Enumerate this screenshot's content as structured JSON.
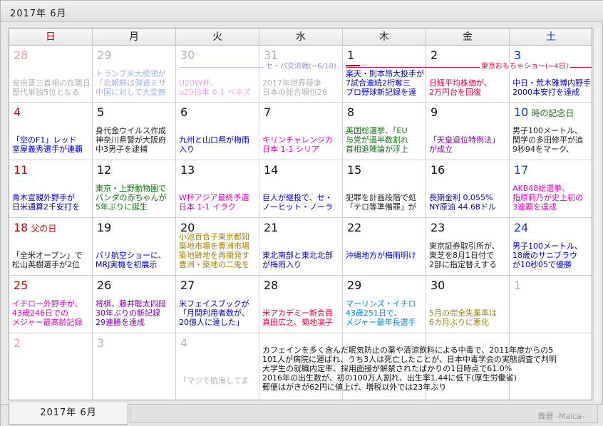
{
  "title": "2017年 6月",
  "brand": "舞暦 -Maica-",
  "tab_label": "2017年 6月",
  "weekdays": [
    "日",
    "月",
    "火",
    "水",
    "木",
    "金",
    "土"
  ],
  "span_events": [
    {
      "label": "セ・パ交流戦(~6/18)",
      "color": "#c0c0e0"
    },
    {
      "label": "東京おもちゃショー(~4日)",
      "color": "#e00040"
    }
  ],
  "weeks": [
    [
      {
        "num": "28",
        "cls": "other-sun",
        "news": [
          [
            "安倍晋三首相の在職日",
            "#b0b0b0"
          ],
          [
            "歴代単独5位となる",
            "#b0b0b0"
          ]
        ]
      },
      {
        "num": "29",
        "cls": "other",
        "news": [
          [
            "トランプ米大統領が",
            "#a0b0e0"
          ],
          [
            "「北朝鮮は弾道ミサ",
            "#a0b0e0"
          ],
          [
            "中国に対して大変無",
            "#a0b0e0"
          ]
        ]
      },
      {
        "num": "30",
        "cls": "other",
        "news": [
          [
            "U20W杯、",
            "#f0a0e0"
          ],
          [
            "u20日本 0-1 ベネズ",
            "#f0a0e0"
          ]
        ]
      },
      {
        "num": "31",
        "cls": "other",
        "news": [
          [
            "2017年世界競争",
            "#b0b0b0"
          ],
          [
            "日本の総合順位26",
            "#b0b0b0"
          ]
        ]
      },
      {
        "num": "1",
        "cls": "",
        "news": [
          [
            "楽天・則本昂大投手が",
            "#0000d0"
          ],
          [
            "7試合連続2桁奪三",
            "#0000d0"
          ],
          [
            "プロ野球新記録を達",
            "#0000d0"
          ]
        ]
      },
      {
        "num": "2",
        "cls": "",
        "news": [
          [
            "日経平均株価が、",
            "#e00040"
          ],
          [
            "2万円台を回復",
            "#e00040"
          ]
        ]
      },
      {
        "num": "3",
        "cls": "sat",
        "news": [
          [
            "中日・荒木雅博内野手",
            "#0000d0"
          ],
          [
            "2000本安打を達成",
            "#0000d0"
          ]
        ]
      }
    ],
    [
      {
        "num": "4",
        "cls": "sun",
        "news": [
          [
            "「空のF1」レッド",
            "#0000d0"
          ],
          [
            "室屋義秀選手が連覇",
            "#0000d0"
          ]
        ]
      },
      {
        "num": "5",
        "cls": "",
        "news": [
          [
            "身代金ウイルス作成",
            "#222222"
          ],
          [
            "神奈川県警が大阪府",
            "#222222"
          ],
          [
            "中3男子を逮捕",
            "#222222"
          ]
        ]
      },
      {
        "num": "6",
        "cls": "",
        "news": [
          [
            "九州と山口県が梅雨",
            "#0000d0"
          ],
          [
            "入り",
            "#0000d0"
          ]
        ]
      },
      {
        "num": "7",
        "cls": "",
        "news": [
          [
            "キリンチャレンジカ",
            "#e000c0"
          ],
          [
            "日本 1-1 シリア",
            "#e000c0"
          ]
        ]
      },
      {
        "num": "8",
        "cls": "",
        "news": [
          [
            "英国総選挙、「EU",
            "#107010"
          ],
          [
            "与党が過半数割れ",
            "#107010"
          ],
          [
            "首相退陣論が浮上",
            "#107010"
          ]
        ]
      },
      {
        "num": "9",
        "cls": "",
        "news": [
          [
            "「天皇退位特例法」",
            "#8000a0"
          ],
          [
            "が成立",
            "#8000a0"
          ]
        ]
      },
      {
        "num": "10",
        "cls": "sat",
        "holiday": "時の記念日",
        "news": [
          [
            "男子100メートル、",
            "#222222"
          ],
          [
            "関学の多田修平が追",
            "#222222"
          ],
          [
            "9秒94をマーク、",
            "#222222"
          ]
        ]
      }
    ],
    [
      {
        "num": "11",
        "cls": "sun",
        "news": [
          [
            "青木宣親外野手が",
            "#0000d0"
          ],
          [
            "日米通算2千安打を",
            "#0000d0"
          ]
        ]
      },
      {
        "num": "12",
        "cls": "",
        "news": [
          [
            "東京・上野動物園で",
            "#107010"
          ],
          [
            "パンダの赤ちゃんが",
            "#107010"
          ],
          [
            "5年ぶりに誕生",
            "#107010"
          ]
        ]
      },
      {
        "num": "13",
        "cls": "",
        "news": [
          [
            "W杯アジア最終予選",
            "#e000c0"
          ],
          [
            "日本 1-1 イラク",
            "#e000c0"
          ]
        ]
      },
      {
        "num": "14",
        "cls": "",
        "news": [
          [
            "巨人が継投で、セ・",
            "#0000d0"
          ],
          [
            "ノーヒット・ノーラ",
            "#0000d0"
          ]
        ]
      },
      {
        "num": "15",
        "cls": "",
        "news": [
          [
            "犯罪を計画段階で処",
            "#222222"
          ],
          [
            "「テロ等準備罪」が",
            "#222222"
          ]
        ]
      },
      {
        "num": "16",
        "cls": "",
        "news": [
          [
            "長期金利 0.055%",
            "#0000d0"
          ],
          [
            "NY原油 44.68ドル",
            "#0000d0"
          ]
        ]
      },
      {
        "num": "17",
        "cls": "sat",
        "news": [
          [
            "AKB48総選挙、",
            "#e000c0"
          ],
          [
            "指原莉乃が史上初の",
            "#e000c0"
          ],
          [
            "3連覇を達成",
            "#e000c0"
          ]
        ]
      }
    ],
    [
      {
        "num": "18",
        "cls": "sun",
        "holiday": "父の日",
        "news": [
          [
            "「全米オープン」で",
            "#222222"
          ],
          [
            "松山英樹選手が2位",
            "#222222"
          ]
        ]
      },
      {
        "num": "19",
        "cls": "",
        "news": [
          [
            "パリ航空ショーに、",
            "#0000d0"
          ],
          [
            "MRJ実機を初展示",
            "#0000d0"
          ]
        ]
      },
      {
        "num": "20",
        "cls": "",
        "news": [
          [
            "小池百合子東京都知",
            "#a08000"
          ],
          [
            "築地市場を豊洲市場",
            "#a08000"
          ],
          [
            "築地跡地を再開発す",
            "#a08000"
          ],
          [
            "豊洲・築地の二兎を",
            "#a08000"
          ]
        ]
      },
      {
        "num": "21",
        "cls": "",
        "news": [
          [
            "東北南部と東北北部",
            "#0000d0"
          ],
          [
            "が梅雨入り",
            "#0000d0"
          ]
        ]
      },
      {
        "num": "22",
        "cls": "",
        "news": [
          [
            "沖縄地方が梅雨明け",
            "#0000d0"
          ]
        ]
      },
      {
        "num": "23",
        "cls": "",
        "news": [
          [
            "東京証券取引所が、",
            "#222222"
          ],
          [
            "東芝を8月1日付で",
            "#222222"
          ],
          [
            "2部に指定替えする",
            "#222222"
          ]
        ]
      },
      {
        "num": "24",
        "cls": "sat",
        "news": [
          [
            "男子100メートル、",
            "#0000d0"
          ],
          [
            "18歳のサニブラウ",
            "#0000d0"
          ],
          [
            "が10秒05で優勝",
            "#0000d0"
          ]
        ]
      }
    ],
    [
      {
        "num": "25",
        "cls": "sun",
        "news": [
          [
            "イチロー外野手が、",
            "#e000c0"
          ],
          [
            "43歳246日での",
            "#e000c0"
          ],
          [
            "メジャー最高齢記録",
            "#e000c0"
          ]
        ]
      },
      {
        "num": "26",
        "cls": "",
        "news": [
          [
            "将棋、藤井聡太四段",
            "#8000a0"
          ],
          [
            "30年ぶりの新記録",
            "#8000a0"
          ],
          [
            "29連勝を達成",
            "#8000a0"
          ]
        ]
      },
      {
        "num": "27",
        "cls": "",
        "news": [
          [
            "米フェイスブックが",
            "#0000d0"
          ],
          [
            "「月間利用者数が、",
            "#0000d0"
          ],
          [
            "20億人に達した」",
            "#0000d0"
          ]
        ]
      },
      {
        "num": "28",
        "cls": "",
        "news": [
          [
            "米アカデミー新会員",
            "#e00040"
          ],
          [
            "真田広之、菊地凛子",
            "#e00040"
          ]
        ]
      },
      {
        "num": "29",
        "cls": "",
        "news": [
          [
            "マーリンズ・イチロ",
            "#0090d0"
          ],
          [
            "43歳251日で、",
            "#0090d0"
          ],
          [
            "メジャー最年長選手",
            "#0090d0"
          ]
        ]
      },
      {
        "num": "30",
        "cls": "",
        "news": [
          [
            "5月の完全失業率は",
            "#a08000"
          ],
          [
            "6カ月ぶりに悪化",
            "#a08000"
          ]
        ]
      },
      {
        "num": "1",
        "cls": "other-sat",
        "news": []
      }
    ],
    [
      {
        "num": "2",
        "cls": "other-sun",
        "news": []
      },
      {
        "num": "3",
        "cls": "other",
        "news": []
      },
      {
        "num": "4",
        "cls": "other",
        "news": [
          [
            "「マジで航海してま",
            "#b0b0b0"
          ]
        ]
      },
      {
        "num": "",
        "cls": "",
        "news": []
      },
      {
        "num": "",
        "cls": "",
        "news": []
      },
      {
        "num": "",
        "cls": "",
        "news": []
      },
      {
        "num": "",
        "cls": "",
        "news": []
      }
    ]
  ],
  "facts": [
    "カフェインを多く含んだ眠気防止の薬や清涼飲料による中毒で、2011年度からの5",
    "101人が病院に運ばれ、うち3人は死亡したことが、日本中毒学会の実態調査で判明",
    "大学生の就職内定率、採用面接が解禁されたばかりの1日時点で61.0%",
    "2016年の出生数が、初の100万人割れ、出生率1.44に低下(厚生労働省)",
    "郵便はがきが62円に値上げ、増税以外では23年ぶり"
  ]
}
